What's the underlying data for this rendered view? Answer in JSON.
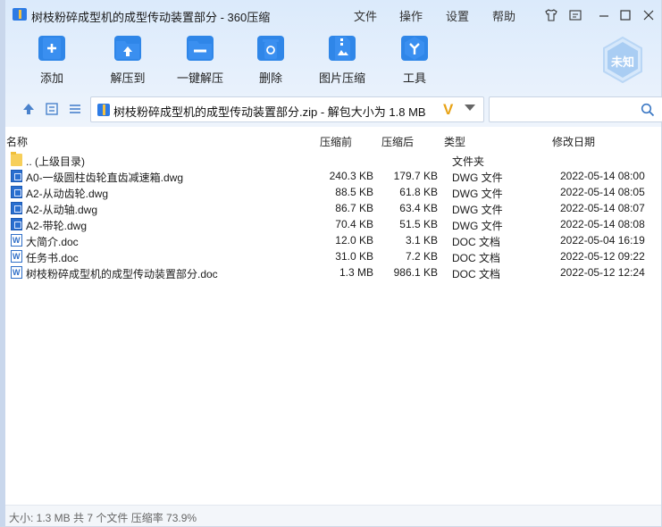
{
  "window": {
    "title": "树枝粉碎成型机的成型传动装置部分 - 360压缩",
    "menus": [
      "文件",
      "操作",
      "设置",
      "帮助"
    ]
  },
  "toolbar": {
    "items": [
      {
        "label": "添加",
        "icon": "add-icon"
      },
      {
        "label": "解压到",
        "icon": "extract-to-icon"
      },
      {
        "label": "一键解压",
        "icon": "one-click-extract-icon"
      },
      {
        "label": "删除",
        "icon": "delete-icon"
      },
      {
        "label": "图片压缩",
        "icon": "image-compress-icon"
      },
      {
        "label": "工具",
        "icon": "tools-icon"
      }
    ],
    "badge": "未知"
  },
  "address": {
    "path": "树枝粉碎成型机的成型传动装置部分.zip - 解包大小为 1.8 MB",
    "search_value": ""
  },
  "columns": {
    "name": "名称",
    "compressed": "压缩前",
    "after": "压缩后",
    "type": "类型",
    "modified": "修改日期"
  },
  "files": [
    {
      "name": ".. (上级目录)",
      "before": "",
      "after": "",
      "type": "文件夹",
      "date": "",
      "kind": "folder"
    },
    {
      "name": "A0-一级圆柱齿轮直齿减速箱.dwg",
      "before": "240.3 KB",
      "after": "179.7 KB",
      "type": "DWG 文件",
      "date": "2022-05-14 08:00",
      "kind": "dwg"
    },
    {
      "name": "A2-从动齿轮.dwg",
      "before": "88.5 KB",
      "after": "61.8 KB",
      "type": "DWG 文件",
      "date": "2022-05-14 08:05",
      "kind": "dwg"
    },
    {
      "name": "A2-从动轴.dwg",
      "before": "86.7 KB",
      "after": "63.4 KB",
      "type": "DWG 文件",
      "date": "2022-05-14 08:07",
      "kind": "dwg"
    },
    {
      "name": "A2-带轮.dwg",
      "before": "70.4 KB",
      "after": "51.5 KB",
      "type": "DWG 文件",
      "date": "2022-05-14 08:08",
      "kind": "dwg"
    },
    {
      "name": "大简介.doc",
      "before": "12.0 KB",
      "after": "3.1 KB",
      "type": "DOC 文档",
      "date": "2022-05-04 16:19",
      "kind": "doc"
    },
    {
      "name": "任务书.doc",
      "before": "31.0 KB",
      "after": "7.2 KB",
      "type": "DOC 文档",
      "date": "2022-05-12 09:22",
      "kind": "doc"
    },
    {
      "name": "树枝粉碎成型机的成型传动装置部分.doc",
      "before": "1.3 MB",
      "after": "986.1 KB",
      "type": "DOC 文档",
      "date": "2022-05-12 12:24",
      "kind": "doc"
    }
  ],
  "status": {
    "text": "大小: 1.3 MB 共 7 个文件 压缩率 73.9%"
  }
}
